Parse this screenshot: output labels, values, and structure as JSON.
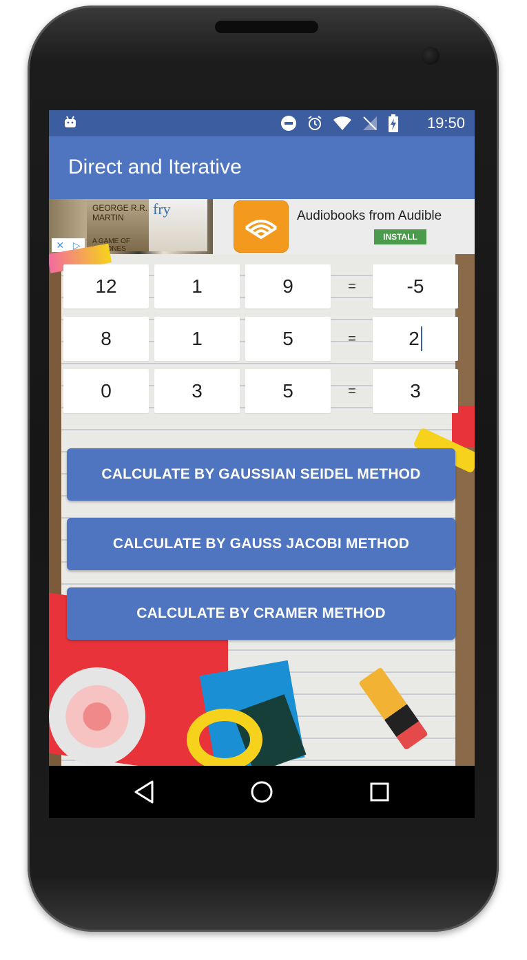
{
  "status_bar": {
    "time": "19:50",
    "icons": [
      "android-icon",
      "do-not-disturb-icon",
      "alarm-icon",
      "wifi-icon",
      "no-sim-icon",
      "battery-charging-icon"
    ]
  },
  "app_bar": {
    "title": "Direct and Iterative"
  },
  "ad": {
    "headline": "Audiobooks from Audible",
    "install_label": "INSTALL",
    "book1_text": "GEORGE R.R. MARTIN",
    "book1_sub": "A GAME OF THRONES",
    "book2_text": "fry",
    "accent": "#f39a1e"
  },
  "matrix": {
    "rows": [
      {
        "a": "12",
        "b": "1",
        "c": "9",
        "eq": "=",
        "r": "-5"
      },
      {
        "a": "8",
        "b": "1",
        "c": "5",
        "eq": "=",
        "r": "2"
      },
      {
        "a": "0",
        "b": "3",
        "c": "5",
        "eq": "=",
        "r": "3"
      }
    ]
  },
  "buttons": {
    "gauss_seidel": "CALCULATE BY GAUSSIAN SEIDEL METHOD",
    "gauss_jacobi": "CALCULATE BY GAUSS JACOBI METHOD",
    "cramer": "CALCULATE BY CRAMER METHOD"
  },
  "colors": {
    "primary": "#4f75c1",
    "status_bar": "#3c5da0"
  },
  "nav_bar": {
    "icons": [
      "back-icon",
      "home-icon",
      "recents-icon"
    ]
  }
}
